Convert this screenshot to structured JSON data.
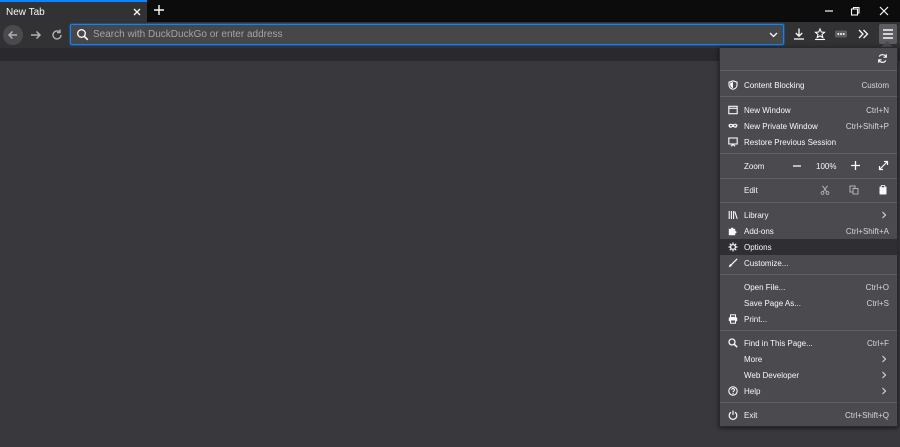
{
  "tab": {
    "title": "New Tab"
  },
  "urlbar": {
    "placeholder": "Search with DuckDuckGo or enter address",
    "value": ""
  },
  "menu": {
    "content_blocking": {
      "label": "Content Blocking",
      "value": "Custom"
    },
    "new_window": {
      "label": "New Window",
      "shortcut": "Ctrl+N"
    },
    "new_private_window": {
      "label": "New Private Window",
      "shortcut": "Ctrl+Shift+P"
    },
    "restore_session": {
      "label": "Restore Previous Session"
    },
    "zoom": {
      "label": "Zoom",
      "level": "100%"
    },
    "edit": {
      "label": "Edit"
    },
    "library": {
      "label": "Library"
    },
    "addons": {
      "label": "Add-ons",
      "shortcut": "Ctrl+Shift+A"
    },
    "options": {
      "label": "Options"
    },
    "customize": {
      "label": "Customize..."
    },
    "open_file": {
      "label": "Open File...",
      "shortcut": "Ctrl+O"
    },
    "save_page": {
      "label": "Save Page As...",
      "shortcut": "Ctrl+S"
    },
    "print": {
      "label": "Print..."
    },
    "find": {
      "label": "Find in This Page...",
      "shortcut": "Ctrl+F"
    },
    "more": {
      "label": "More"
    },
    "web_developer": {
      "label": "Web Developer"
    },
    "help": {
      "label": "Help"
    },
    "exit": {
      "label": "Exit",
      "shortcut": "Ctrl+Shift+Q"
    }
  },
  "colors": {
    "accent": "#0a84ff",
    "background": "#38383d",
    "panel": "#4a4a4f",
    "toolbar": "#323234"
  }
}
